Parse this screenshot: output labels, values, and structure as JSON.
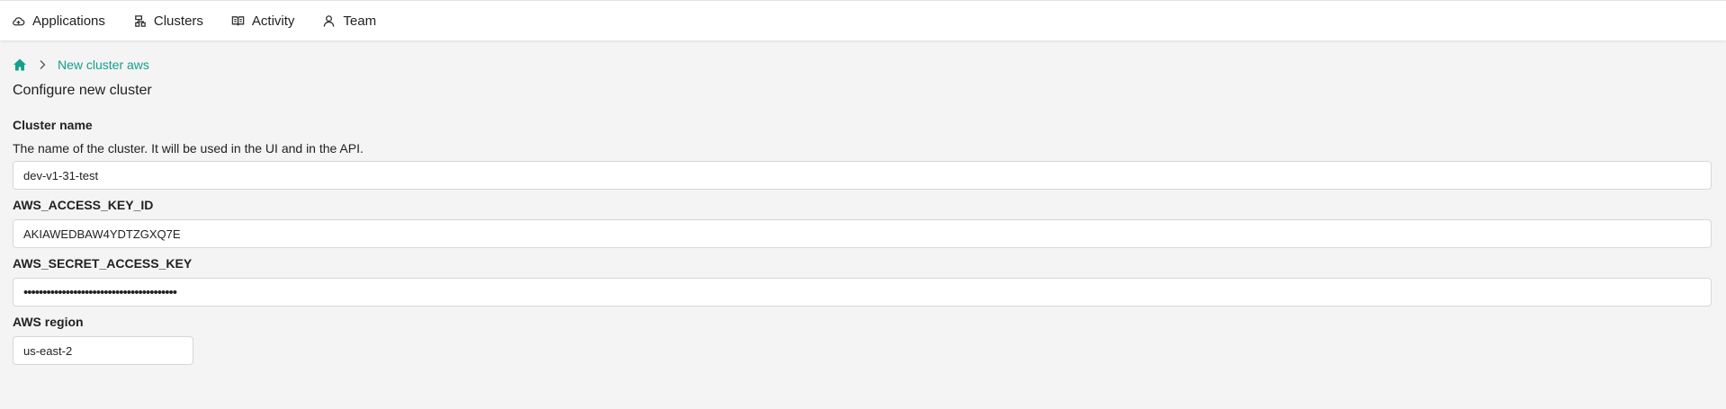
{
  "nav": {
    "items": [
      {
        "label": "Applications",
        "icon": "cloud-icon"
      },
      {
        "label": "Clusters",
        "icon": "cluster-icon"
      },
      {
        "label": "Activity",
        "icon": "book-icon"
      },
      {
        "label": "Team",
        "icon": "user-icon"
      }
    ]
  },
  "breadcrumb": {
    "home_icon": "home-icon",
    "separator_icon": "chevron-right-icon",
    "current": "New cluster aws"
  },
  "page": {
    "title": "Configure new cluster"
  },
  "form": {
    "cluster_name": {
      "label": "Cluster name",
      "description": "The name of the cluster. It will be used in the UI and in the API.",
      "value": "dev-v1-31-test"
    },
    "access_key": {
      "label": "AWS_ACCESS_KEY_ID",
      "value": "AKIAWEDBAW4YDTZGXQ7E"
    },
    "secret_key": {
      "label": "AWS_SECRET_ACCESS_KEY",
      "value": "••••••••••••••••••••••••••••••••••••••••"
    },
    "region": {
      "label": "AWS region",
      "value": "us-east-2"
    }
  },
  "colors": {
    "accent": "#14a08a",
    "background": "#f4f4f4"
  }
}
